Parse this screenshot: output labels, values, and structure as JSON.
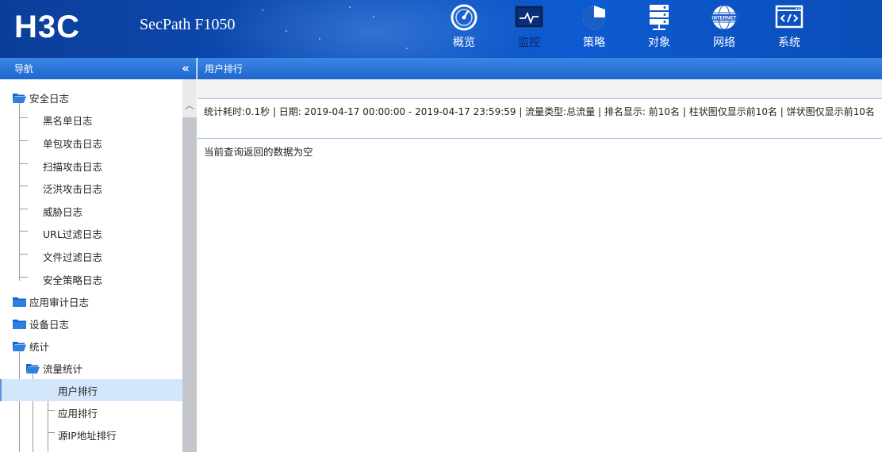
{
  "header": {
    "brand": "H3C",
    "product": "SecPath F1050",
    "nav": [
      {
        "label": "概览",
        "icon": "gauge-icon"
      },
      {
        "label": "监控",
        "icon": "monitor-icon"
      },
      {
        "label": "策略",
        "icon": "shield-icon"
      },
      {
        "label": "对象",
        "icon": "server-icon"
      },
      {
        "label": "网络",
        "icon": "internet-globe-icon",
        "icon_text": "INTERNET"
      },
      {
        "label": "系统",
        "icon": "code-window-icon"
      }
    ],
    "active_nav": "监控"
  },
  "sidebar": {
    "title": "导航",
    "collapse_icon": "«",
    "tree": [
      {
        "label": "安全日志",
        "type": "folder-open"
      },
      {
        "label": "黑名单日志",
        "type": "leaf"
      },
      {
        "label": "单包攻击日志",
        "type": "leaf"
      },
      {
        "label": "扫描攻击日志",
        "type": "leaf"
      },
      {
        "label": "泛洪攻击日志",
        "type": "leaf"
      },
      {
        "label": "威胁日志",
        "type": "leaf"
      },
      {
        "label": "URL过滤日志",
        "type": "leaf"
      },
      {
        "label": "文件过滤日志",
        "type": "leaf"
      },
      {
        "label": "安全策略日志",
        "type": "leaf"
      },
      {
        "label": "应用审计日志",
        "type": "folder-closed"
      },
      {
        "label": "设备日志",
        "type": "folder-closed"
      },
      {
        "label": "统计",
        "type": "folder-open"
      },
      {
        "label": "流量统计",
        "type": "folder-open"
      },
      {
        "label": "用户排行",
        "type": "leaf",
        "selected": true
      },
      {
        "label": "应用排行",
        "type": "leaf"
      },
      {
        "label": "源IP地址排行",
        "type": "leaf"
      }
    ]
  },
  "main": {
    "title": "用户排行",
    "summary": "统计耗时:0.1秒 | 日期: 2019-04-17 00:00:00 - 2019-04-17 23:59:59 | 流量类型:总流量 | 排名显示: 前10名 | 柱状图仅显示前10名 | 饼状图仅显示前10名",
    "empty_message": "当前查询返回的数据为空"
  },
  "colors": {
    "header_blue": "#0c4bb3",
    "panel_head_blue": "#1f66cc",
    "selected_row": "#d4e6fb",
    "folder_blue": "#1a64c8"
  }
}
